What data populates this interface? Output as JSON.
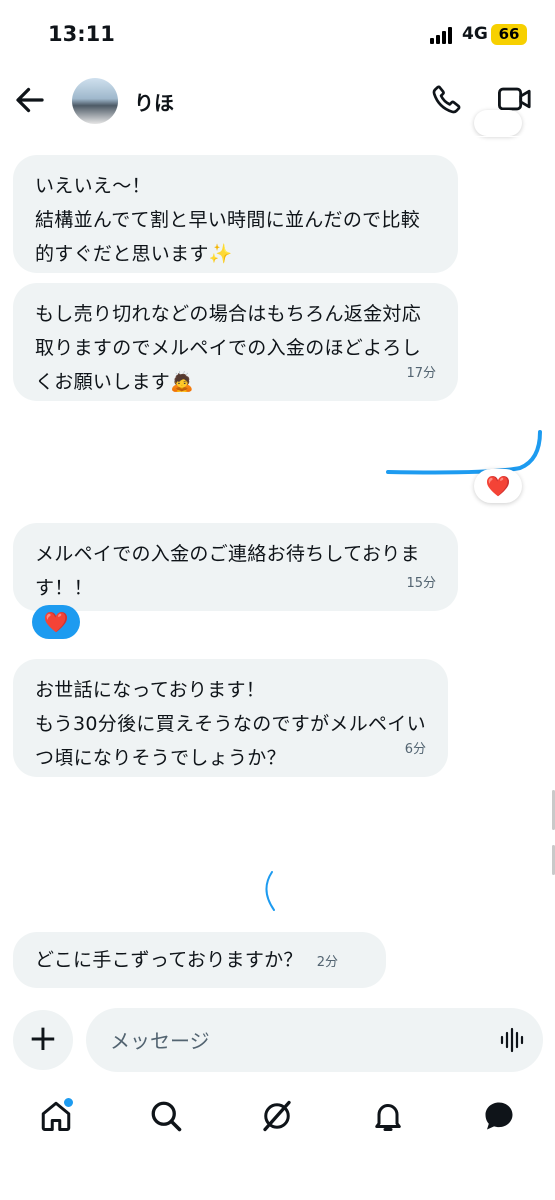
{
  "status_bar": {
    "time": "13:11",
    "network": "4G",
    "battery": "66"
  },
  "header": {
    "contact_name": "りほ",
    "icons": [
      "back-arrow-icon",
      "phone-icon",
      "video-icon"
    ]
  },
  "messages": [
    {
      "text": "いえいえ〜！\n結構並んでて割と早い時間に並んだので比較的すぐだと思います✨",
      "time": ""
    },
    {
      "text": "もし売り切れなどの場合はもちろん返金対応取りますのでメルペイでの入金のほどよろしくお願いします🙇",
      "time": "17分"
    },
    {
      "text": "メルペイでの入金のご連絡お待ちしております！！",
      "time": "15分",
      "reaction": "❤️"
    },
    {
      "text": "お世話になっております！\nもう30分後に買えそうなのですがメルペイいつ頃になりそうでしょうか？",
      "time": "6分"
    },
    {
      "text": "どこに手こずっておりますか？",
      "time": "2分"
    }
  ],
  "own_message_reaction": "❤️",
  "composer": {
    "placeholder": "メッセージ",
    "plus": "+"
  },
  "nav": [
    "home-icon",
    "search-icon",
    "grok-icon",
    "notifications-icon",
    "messages-icon"
  ],
  "colors": {
    "accent": "#1d9bf0",
    "bubble_bg": "#eff3f4",
    "battery": "#f7d000"
  }
}
